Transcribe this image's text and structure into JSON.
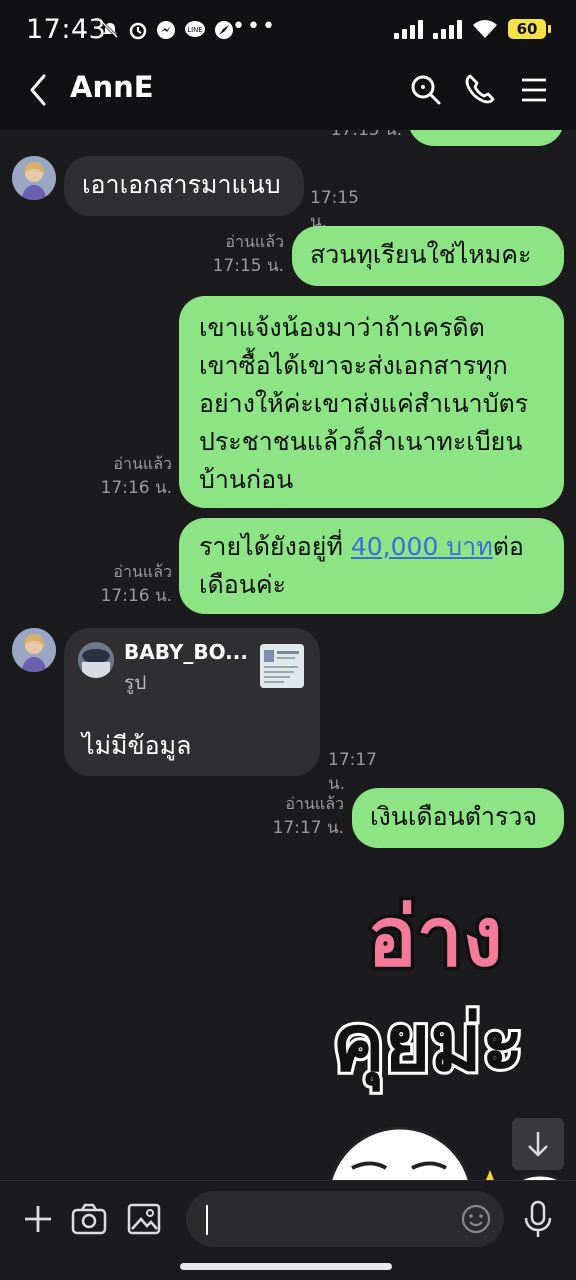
{
  "status_bar": {
    "time": "17:43",
    "overflow": "•••",
    "battery": "60"
  },
  "header": {
    "title": "AnnE",
    "icons": [
      "back-icon",
      "search-icon",
      "phone-icon",
      "menu-icon"
    ]
  },
  "messages": {
    "partial_time": "17:15 น.",
    "m1": {
      "text": "เอาเอกสารมาแนบ",
      "time": "17:15 น."
    },
    "m2": {
      "text": "สวนทุเรียนใช่ไหมคะ",
      "read": "อ่านแล้ว",
      "time": "17:15 น."
    },
    "m3": {
      "lines": [
        "เขาแจ้งน้องมาว่าถ้าเครดิต",
        "เขาซื้อได้เขาจะส่งเอกสารทุก",
        "อย่างให้ค่ะเขาส่งแค่สำเนาบัตร",
        "ประชาชนแล้วก็สำเนาทะเบียน",
        "บ้านก่อน"
      ],
      "read": "อ่านแล้ว",
      "time": "17:16 น."
    },
    "m4": {
      "prefix": "รายได้ยังอยู่ที่ ",
      "link": "40,000 บาท",
      "suffix": "ต่อ",
      "line2": "เดือนค่ะ",
      "read": "อ่านแล้ว",
      "time": "17:16 น."
    },
    "m5": {
      "reply_name": "BABY_BO...",
      "reply_type": "รูป",
      "text": "ไม่มีข้อมูล",
      "time": "17:17 น."
    },
    "m6": {
      "text": "เงินเดือนตำรวจ",
      "read": "อ่านแล้ว",
      "time": "17:17 น."
    },
    "sticker": {
      "line1": "อ่าง",
      "line2": "คุยม่ะ"
    }
  },
  "colors": {
    "outgoing": "#8de485",
    "incoming": "#2f2f31",
    "background": "#1b1b1d",
    "link": "#3b6fd6"
  }
}
